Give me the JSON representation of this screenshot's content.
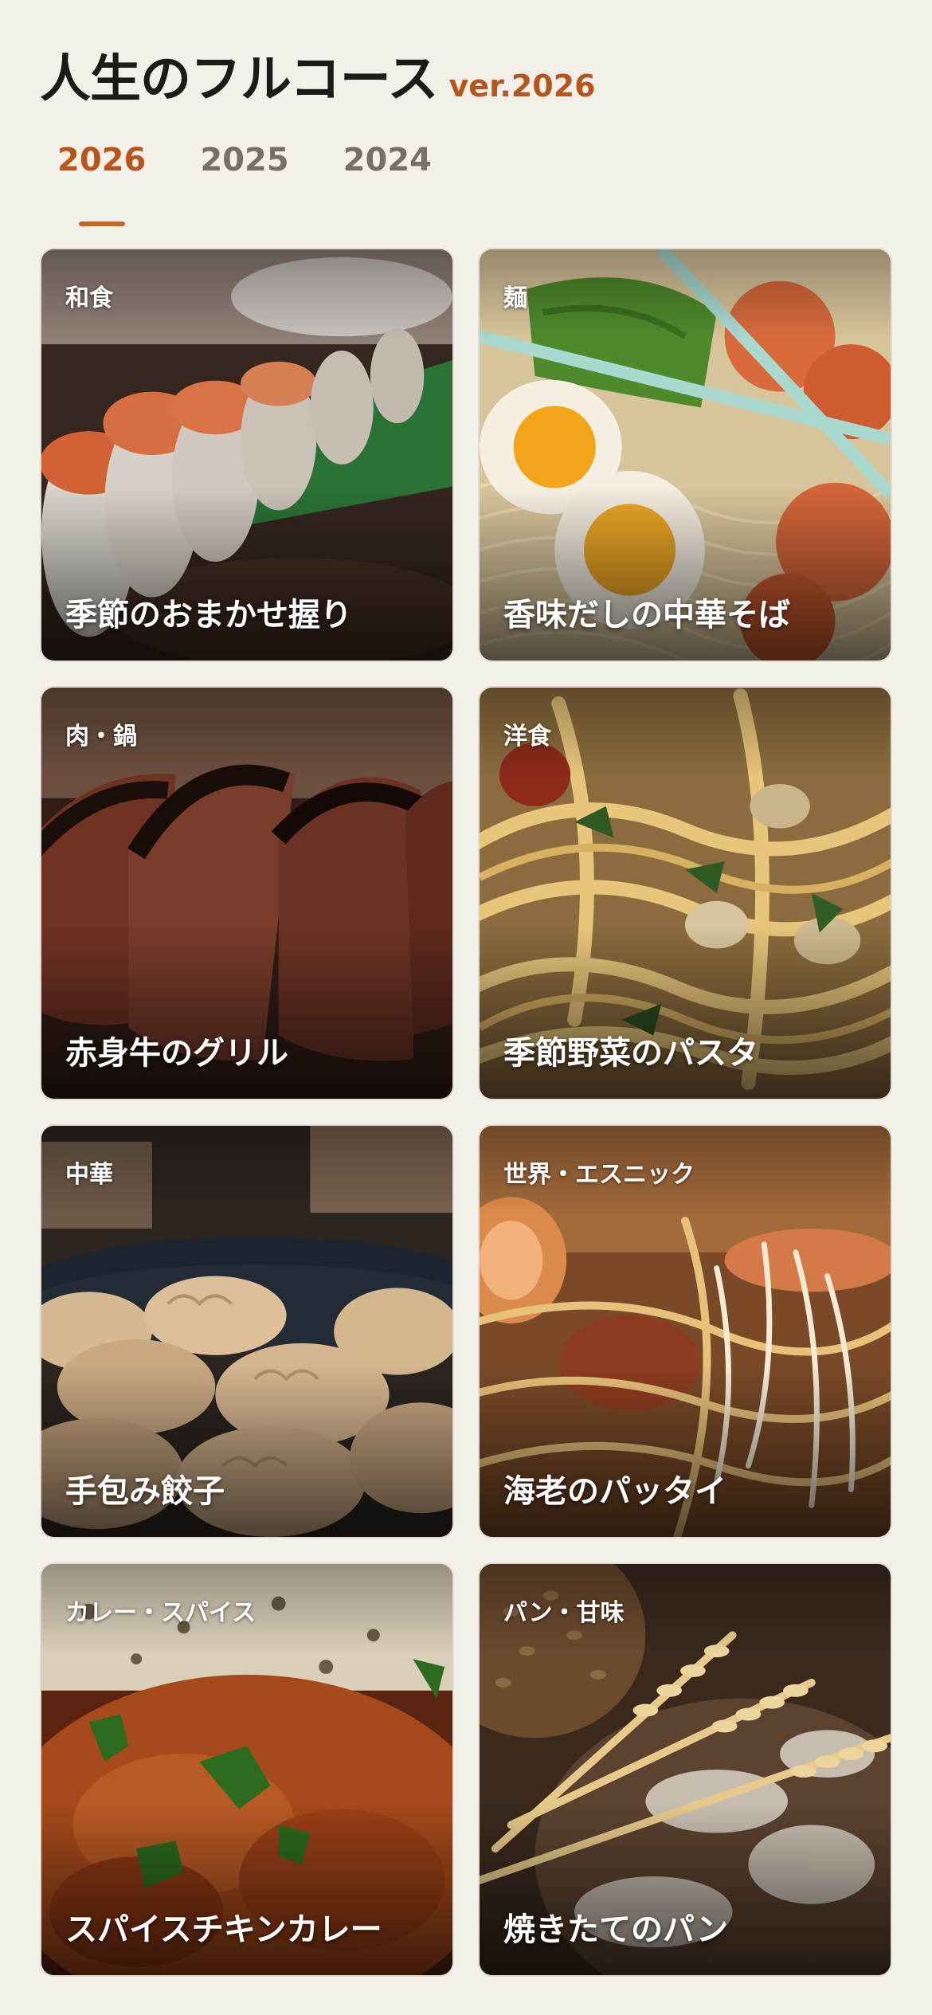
{
  "header": {
    "title": "人生のフルコース",
    "version": "ver.2026"
  },
  "tabs": [
    {
      "label": "2026",
      "active": true
    },
    {
      "label": "2025",
      "active": false
    },
    {
      "label": "2024",
      "active": false
    }
  ],
  "cards": [
    {
      "category": "和食",
      "name": "季節のおまかせ握り",
      "image": "sushi-photo"
    },
    {
      "category": "麺",
      "name": "香味だしの中華そば",
      "image": "ramen-photo"
    },
    {
      "category": "肉・鍋",
      "name": "赤身牛のグリル",
      "image": "steak-photo"
    },
    {
      "category": "洋食",
      "name": "季節野菜のパスタ",
      "image": "pasta-photo"
    },
    {
      "category": "中華",
      "name": "手包み餃子",
      "image": "dumplings-photo"
    },
    {
      "category": "世界・エスニック",
      "name": "海老のパッタイ",
      "image": "pad-thai-photo"
    },
    {
      "category": "カレー・スパイス",
      "name": "スパイスチキンカレー",
      "image": "curry-photo"
    },
    {
      "category": "パン・甘味",
      "name": "焼きたてのパン",
      "image": "bread-photo"
    }
  ],
  "colors": {
    "accent": "#b4561d",
    "background": "#f3efe9",
    "tab_inactive": "#77706a"
  }
}
